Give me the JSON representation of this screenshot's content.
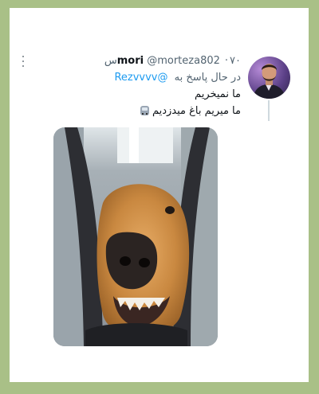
{
  "tweet": {
    "display_name": "mori",
    "handle": "@morteza802",
    "separator": "·",
    "time": "۷۰س",
    "reply_prefix": "در حال پاسخ به",
    "reply_to": "@Rezvvvv",
    "text_lines": [
      "ما نمیخریم",
      "ما میریم باغ میدزدیم"
    ],
    "emoji": "bus-stop-icon"
  },
  "colors": {
    "background": "#a9c087",
    "card": "#ffffff",
    "primary_text": "#0f1419",
    "secondary_text": "#536471",
    "link": "#1d9bf0"
  }
}
